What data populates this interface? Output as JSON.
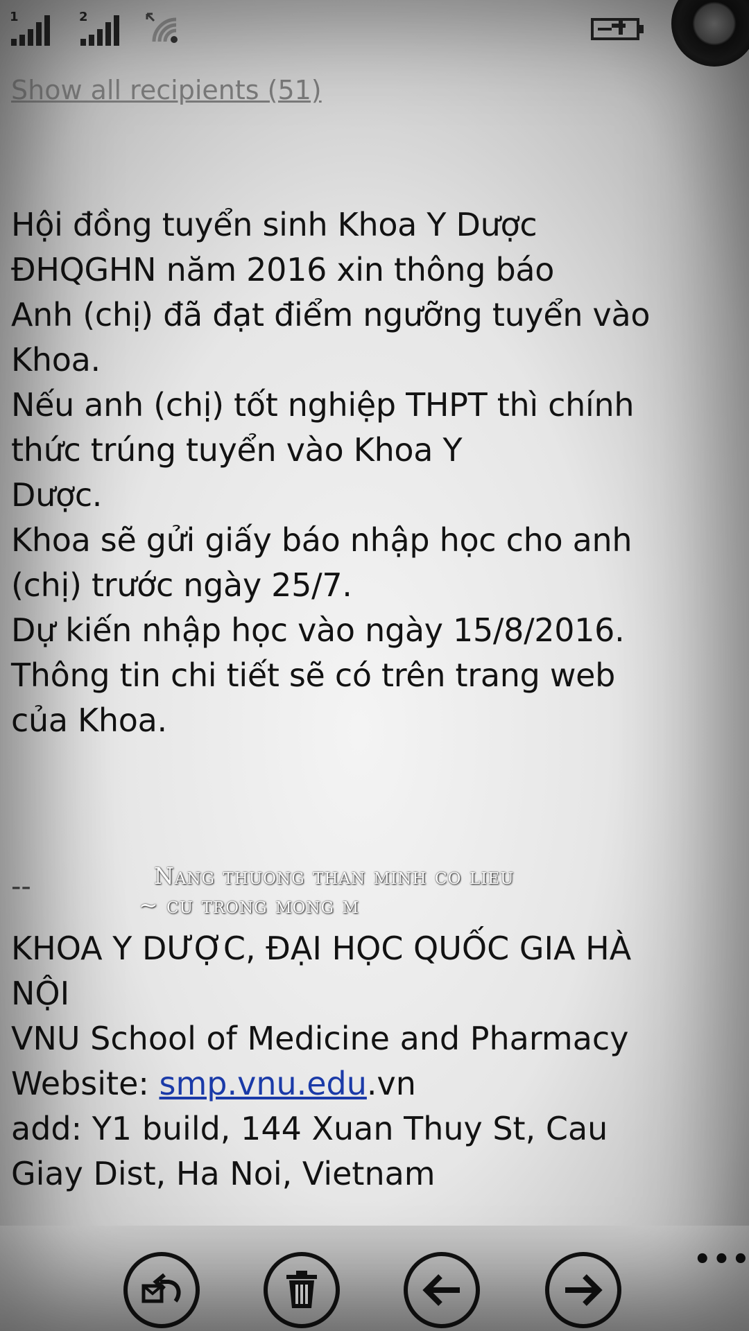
{
  "status_bar": {
    "sim1_label": "1",
    "sim2_label": "2",
    "icons": [
      "signal-strength-icon",
      "signal-strength-icon",
      "wifi-icon",
      "battery-charging-icon"
    ]
  },
  "mail": {
    "show_recipients": "Show all recipients (51)",
    "body_lines": [
      "Hội đồng tuyển sinh Khoa Y Dược",
      "ĐHQGHN năm 2016 xin thông báo",
      "Anh (chị) đã đạt điểm ngưỡng tuyển vào",
      "Khoa.",
      "Nếu anh (chị) tốt nghiệp THPT thì chính",
      "thức trúng tuyển vào Khoa Y",
      "Dược.",
      "Khoa sẽ gửi giấy báo nhập học cho anh",
      "(chị) trước ngày 25/7.",
      "Dự kiến nhập học vào ngày 15/8/2016.",
      "Thông tin chi tiết sẽ có trên trang web",
      "của Khoa."
    ],
    "separator": "--",
    "signature": {
      "line1": "KHOA Y DƯỢC, ĐẠI HỌC QUỐC GIA HÀ",
      "line2": "NỘI",
      "line3": "VNU School of Medicine and Pharmacy",
      "website_prefix": "Website: ",
      "website_link": "smp.vnu.edu",
      "website_suffix": ".vn",
      "line5": "add: Y1 build, 144 Xuan Thuy St, Cau",
      "line6": "Giay Dist, Ha Noi, Vietnam"
    }
  },
  "overlay": {
    "line1": "Nang thuong than minh co lieu",
    "line2": "~ cu trong mong m"
  },
  "app_bar": {
    "more_label": "•••",
    "buttons": [
      "reply-icon",
      "delete-icon",
      "previous-icon",
      "next-icon"
    ]
  },
  "colors": {
    "link": "#1a3aa8",
    "recipients": "#7a7a7a",
    "text": "#121212"
  }
}
